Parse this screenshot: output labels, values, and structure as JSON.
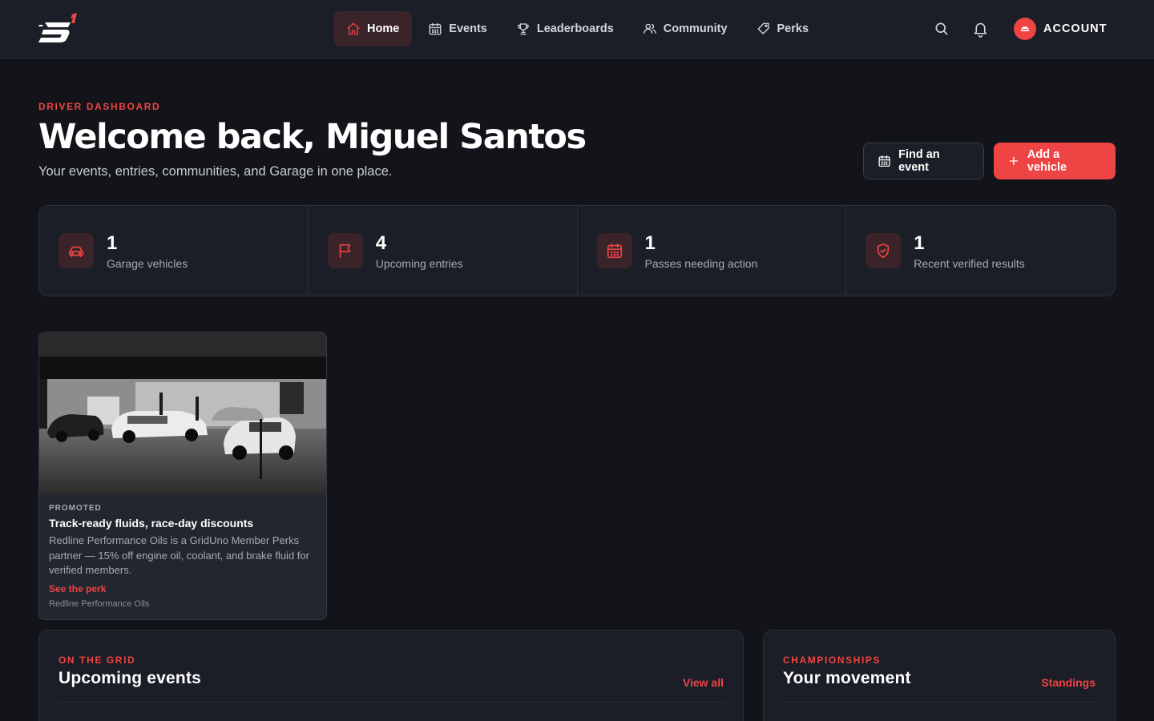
{
  "header": {
    "nav": [
      {
        "label": "Home",
        "icon": "home-icon",
        "active": true
      },
      {
        "label": "Events",
        "icon": "calendar-icon",
        "active": false
      },
      {
        "label": "Leaderboards",
        "icon": "trophy-icon",
        "active": false
      },
      {
        "label": "Community",
        "icon": "users-icon",
        "active": false
      },
      {
        "label": "Perks",
        "icon": "tag-icon",
        "active": false
      }
    ],
    "account_label": "ACCOUNT"
  },
  "hero": {
    "eyebrow": "DRIVER DASHBOARD",
    "title": "Welcome back, Miguel Santos",
    "subtitle": "Your events, entries, communities, and Garage in one place.",
    "find_event_label": "Find an event",
    "add_vehicle_label": "Add a vehicle"
  },
  "stats": [
    {
      "value": "1",
      "label": "Garage vehicles",
      "icon": "car-icon"
    },
    {
      "value": "4",
      "label": "Upcoming entries",
      "icon": "flag-icon"
    },
    {
      "value": "1",
      "label": "Passes needing action",
      "icon": "calendar-icon"
    },
    {
      "value": "1",
      "label": "Recent verified results",
      "icon": "shield-check-icon"
    }
  ],
  "promo": {
    "tag": "PROMOTED",
    "title": "Track-ready fluids, race-day discounts",
    "body": "Redline Performance Oils is a GridUno Member Perks partner — 15% off engine oil, coolant, and brake fluid for verified members.",
    "link": "See the perk",
    "sponsor": "Redline Performance Oils"
  },
  "panels": {
    "events": {
      "eyebrow": "ON THE GRID",
      "title": "Upcoming events",
      "link": "View all"
    },
    "championships": {
      "eyebrow": "CHAMPIONSHIPS",
      "title": "Your movement",
      "link": "Standings"
    }
  },
  "colors": {
    "accent": "#ef4444",
    "background": "#121419",
    "surface": "#1b1e26"
  }
}
